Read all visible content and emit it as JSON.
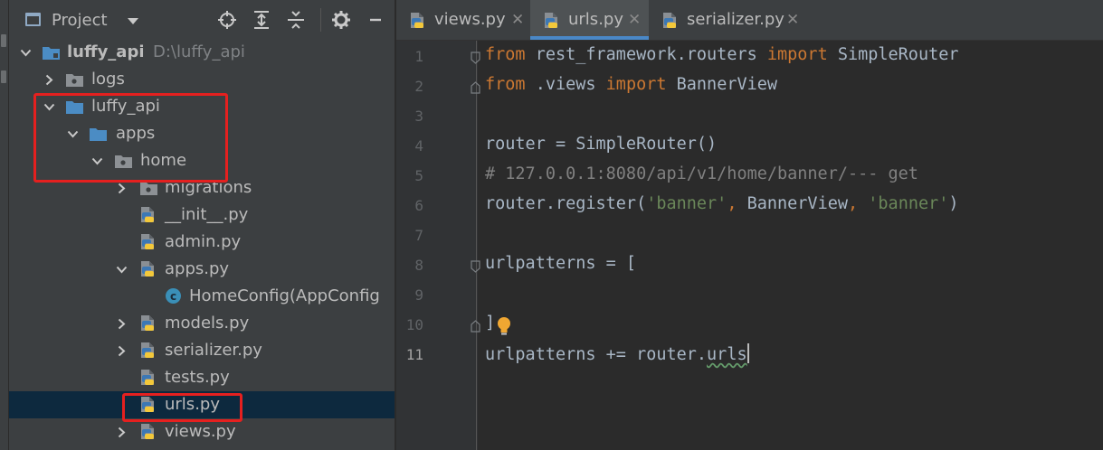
{
  "project_panel": {
    "title": "Project",
    "tree": [
      {
        "label": "luffy_api",
        "path": "D:\\luffy_api",
        "icon": "module-folder-icon",
        "expand": "expanded",
        "bold": true
      },
      {
        "label": "logs",
        "icon": "folder-icon",
        "expand": "collapsed"
      },
      {
        "label": "luffy_api",
        "icon": "package-folder-icon",
        "expand": "expanded"
      },
      {
        "label": "apps",
        "icon": "package-folder-icon",
        "expand": "expanded"
      },
      {
        "label": "home",
        "icon": "folder-icon",
        "expand": "expanded"
      },
      {
        "label": "migrations",
        "icon": "folder-icon",
        "expand": "collapsed"
      },
      {
        "label": "__init__.py",
        "icon": "python-file-icon",
        "expand": "none"
      },
      {
        "label": "admin.py",
        "icon": "python-file-icon",
        "expand": "none"
      },
      {
        "label": "apps.py",
        "icon": "python-file-icon",
        "expand": "expanded"
      },
      {
        "label": "HomeConfig(AppConfig",
        "icon": "class-icon",
        "expand": "none"
      },
      {
        "label": "models.py",
        "icon": "python-file-icon",
        "expand": "collapsed"
      },
      {
        "label": "serializer.py",
        "icon": "python-file-icon",
        "expand": "collapsed"
      },
      {
        "label": "tests.py",
        "icon": "python-file-icon",
        "expand": "none"
      },
      {
        "label": "urls.py",
        "icon": "python-file-icon",
        "expand": "none",
        "selected": true
      },
      {
        "label": "views.py",
        "icon": "python-file-icon",
        "expand": "collapsed"
      }
    ]
  },
  "tabs": [
    {
      "label": "views.py",
      "active": false
    },
    {
      "label": "urls.py",
      "active": true
    },
    {
      "label": "serializer.py",
      "active": false
    }
  ],
  "tab_close_glyph": "✕",
  "editor": {
    "line_numbers": [
      "1",
      "2",
      "3",
      "4",
      "5",
      "6",
      "7",
      "8",
      "9",
      "10",
      "11"
    ],
    "current_line": "11",
    "lines": [
      {
        "parts": [
          {
            "t": "from",
            "c": "kw"
          },
          {
            "t": " rest_framework.routers ",
            "c": ""
          },
          {
            "t": "import",
            "c": "kw"
          },
          {
            "t": " SimpleRouter",
            "c": ""
          }
        ]
      },
      {
        "parts": [
          {
            "t": "from",
            "c": "kw"
          },
          {
            "t": " .views ",
            "c": ""
          },
          {
            "t": "import",
            "c": "kw"
          },
          {
            "t": " BannerView",
            "c": ""
          }
        ]
      },
      {
        "parts": []
      },
      {
        "parts": [
          {
            "t": "router = SimpleRouter()",
            "c": ""
          }
        ]
      },
      {
        "parts": [
          {
            "t": "# 127.0.0.1:8080/api/v1/home/banner/--- get",
            "c": "cm"
          }
        ]
      },
      {
        "parts": [
          {
            "t": "router.register(",
            "c": ""
          },
          {
            "t": "'banner'",
            "c": "str"
          },
          {
            "t": ", ",
            "c": "kw"
          },
          {
            "t": "BannerView",
            "c": ""
          },
          {
            "t": ", ",
            "c": "kw"
          },
          {
            "t": "'banner'",
            "c": "str"
          },
          {
            "t": ")",
            "c": ""
          }
        ]
      },
      {
        "parts": []
      },
      {
        "parts": [
          {
            "t": "urlpatterns = [",
            "c": ""
          }
        ]
      },
      {
        "parts": []
      },
      {
        "parts": [
          {
            "t": "]",
            "c": ""
          }
        ]
      },
      {
        "parts": [
          {
            "t": "urlpatterns += router.",
            "c": ""
          },
          {
            "t": "urls",
            "c": "squig"
          }
        ]
      }
    ]
  },
  "colors": {
    "highlight": "#e5201f",
    "accent": "#4a88c7"
  }
}
